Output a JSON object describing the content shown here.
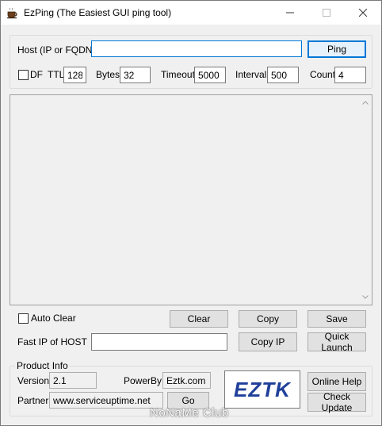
{
  "window": {
    "title": "EzPing (The Easiest GUI ping tool)"
  },
  "host": {
    "label": "Host (IP or FQDN)",
    "value": "",
    "ping_button": "Ping"
  },
  "options": {
    "df_label": "DF",
    "df_checked": false,
    "ttl_label": "TTL",
    "ttl_value": "128",
    "bytes_label": "Bytes",
    "bytes_value": "32",
    "timeout_label": "Timeout",
    "timeout_value": "5000",
    "interval_label": "Interval",
    "interval_value": "500",
    "count_label": "Count",
    "count_value": "4"
  },
  "output": {
    "text": ""
  },
  "actions": {
    "auto_clear_label": "Auto Clear",
    "auto_clear_checked": false,
    "clear": "Clear",
    "copy": "Copy",
    "save": "Save"
  },
  "fast_ip": {
    "label": "Fast IP of HOST",
    "value": "",
    "copy_ip": "Copy IP",
    "quick_launch": "Quick Launch"
  },
  "product_info": {
    "group_label": "Product Info",
    "version_label": "Version",
    "version_value": "2.1",
    "powerby_label": "PowerBy",
    "powerby_value": "Eztk.com",
    "partner_label": "Partner",
    "partner_value": "www.serviceuptime.net",
    "go": "Go",
    "logo_text": "EZTK",
    "online_help": "Online Help",
    "check_update": "Check Update"
  },
  "watermark": "NoNaMe Club",
  "colors": {
    "accent": "#0078d7",
    "logo_blue": "#1f3f9a",
    "window_bg": "#f0f0f0"
  }
}
